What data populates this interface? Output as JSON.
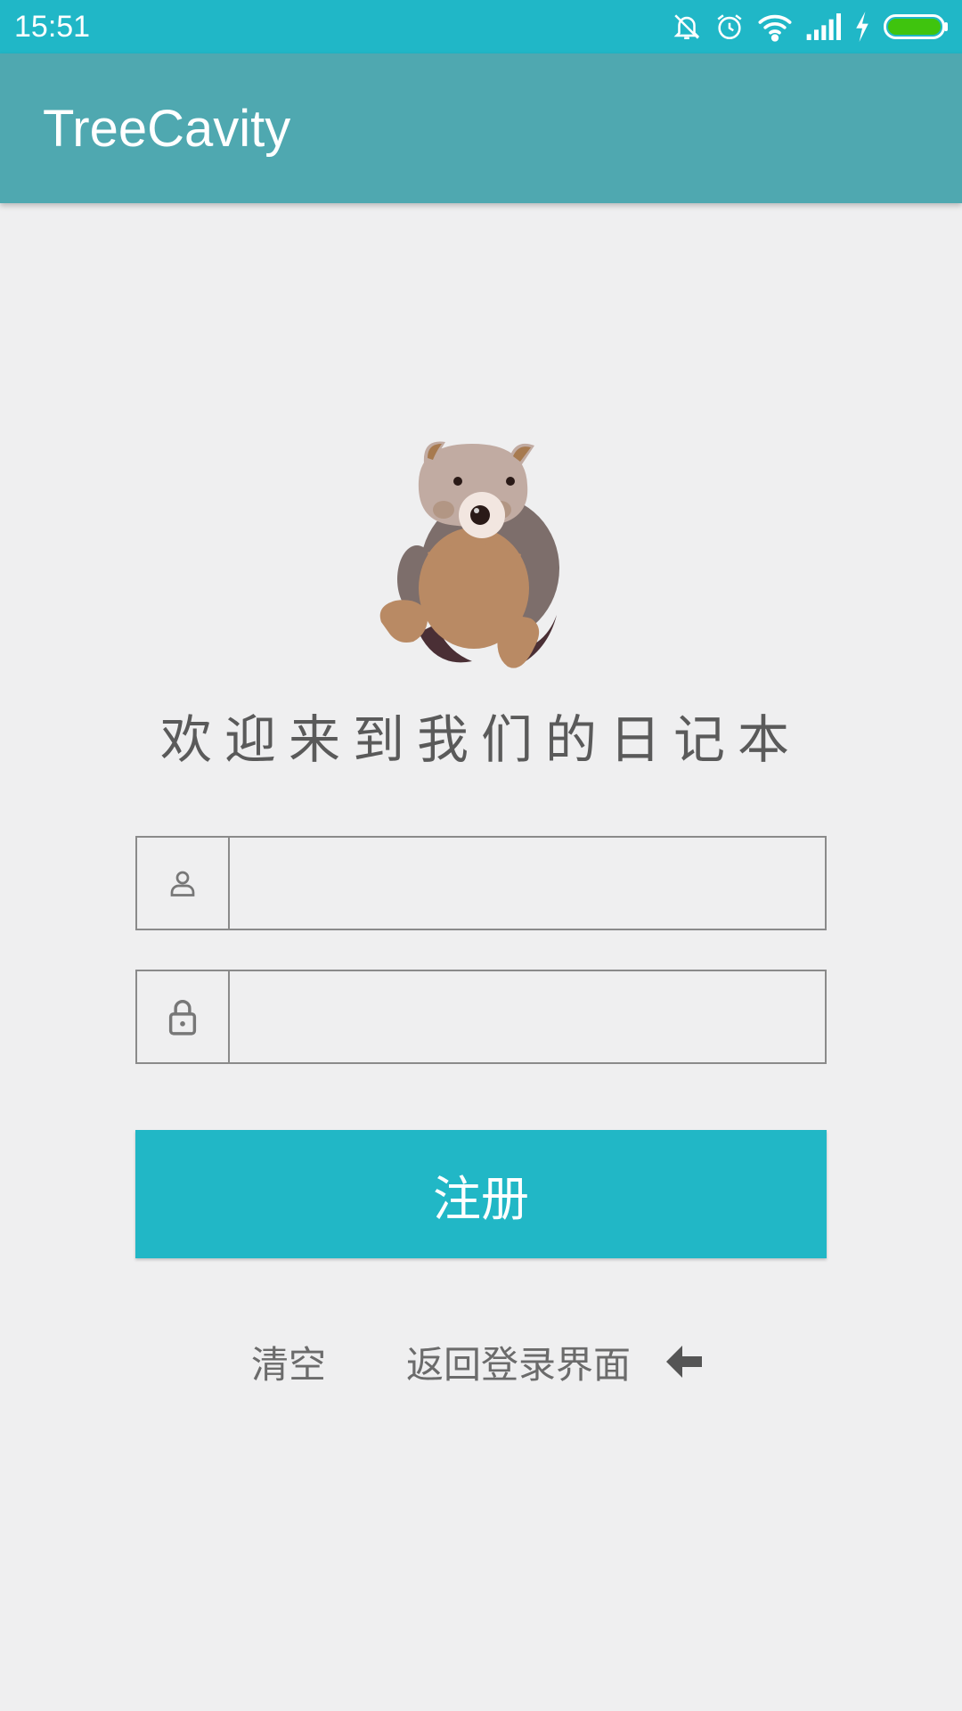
{
  "status_bar": {
    "time": "15:51",
    "icons": [
      "bell-off-icon",
      "alarm-icon",
      "wifi-icon",
      "signal-icon",
      "charging-icon",
      "battery-icon"
    ],
    "battery_color": "#3fc40e"
  },
  "app_bar": {
    "title": "TreeCavity",
    "color": "#4fa8b0"
  },
  "welcome_text": "欢迎来到我们的日记本",
  "username_field": {
    "icon": "person-icon",
    "value": "",
    "placeholder": ""
  },
  "password_field": {
    "icon": "lock-icon",
    "value": "",
    "placeholder": ""
  },
  "register_button": {
    "label": "注册",
    "color": "#21b7c6"
  },
  "links": {
    "clear": "清空",
    "back_to_login": "返回登录界面",
    "back_icon": "arrow-left-icon"
  }
}
